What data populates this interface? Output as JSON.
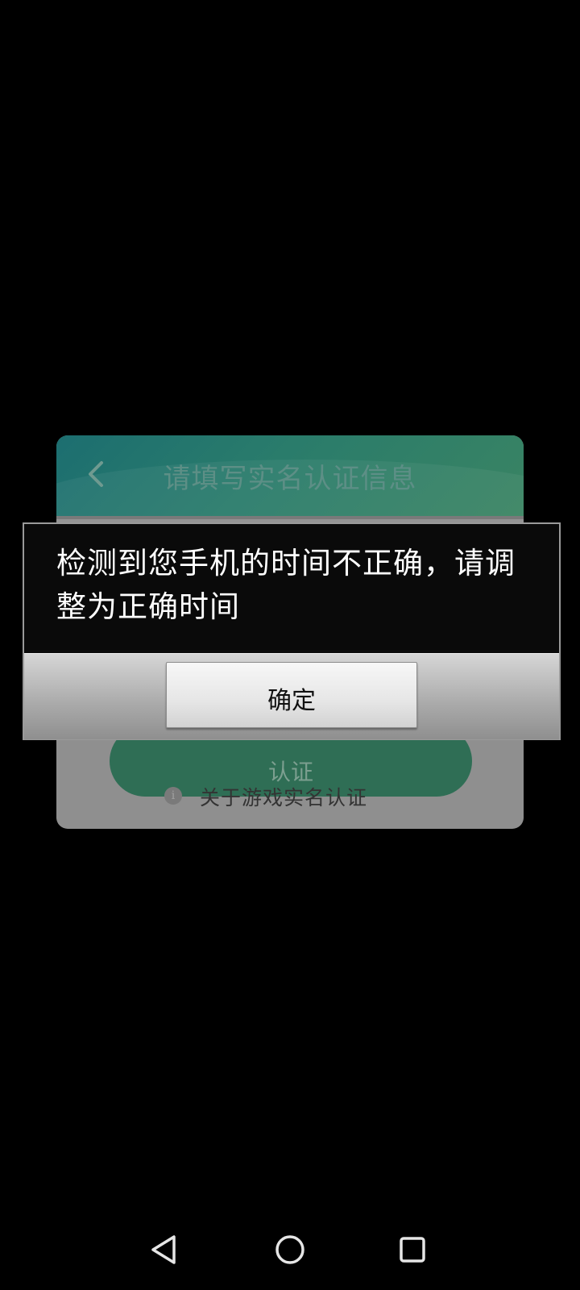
{
  "background_card": {
    "title": "请填写实名认证信息",
    "back_icon": "chevron-left-icon",
    "confirm_label": "认证",
    "about_icon": "info-icon",
    "about_text": "关于游戏实名认证",
    "header_color": "#2a7c6b"
  },
  "dialog": {
    "message": "检测到您手机的时间不正确，请调整为正确时间",
    "ok_label": "确定"
  },
  "navbar": {
    "back_icon": "triangle-back-icon",
    "home_icon": "circle-home-icon",
    "recents_icon": "square-recents-icon"
  }
}
